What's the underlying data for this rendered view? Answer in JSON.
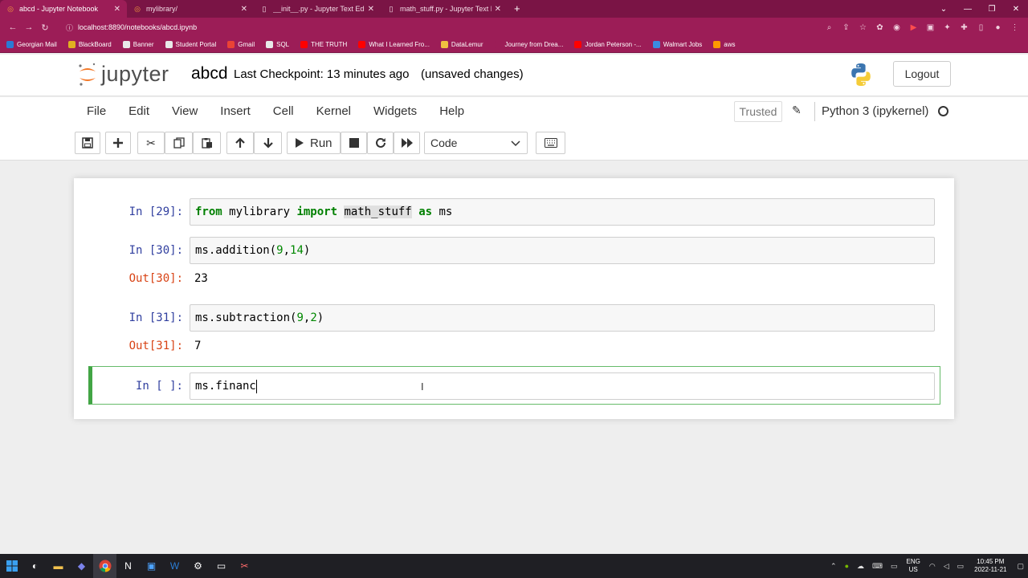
{
  "browser": {
    "tabs": [
      {
        "label": "abcd - Jupyter Notebook",
        "active": true,
        "icon": "jupyter-icon"
      },
      {
        "label": "mylibrary/",
        "active": false,
        "icon": "jupyter-icon"
      },
      {
        "label": "__init__.py - Jupyter Text Editor",
        "active": false,
        "icon": "file-icon"
      },
      {
        "label": "math_stuff.py - Jupyter Text Edito",
        "active": false,
        "icon": "file-icon"
      }
    ],
    "new_tab": "+",
    "url": "localhost:8890/notebooks/abcd.ipynb",
    "bookmarks": [
      {
        "label": "Georgian Mail",
        "color": "#2a7bd4"
      },
      {
        "label": "BlackBoard",
        "color": "#e0b020"
      },
      {
        "label": "Banner",
        "color": "#e8e8e8"
      },
      {
        "label": "Student Portal",
        "color": "#e8e8e8"
      },
      {
        "label": "Gmail",
        "color": "#ea4335"
      },
      {
        "label": "SQL",
        "color": "#e8e8e8"
      },
      {
        "label": "THE TRUTH",
        "color": "#ff0000"
      },
      {
        "label": "What I Learned Fro...",
        "color": "#ff0000"
      },
      {
        "label": "DataLemur",
        "color": "#f0c040"
      },
      {
        "label": "Journey from Drea...",
        "color": "#9c1d57"
      },
      {
        "label": "Jordan Peterson -...",
        "color": "#ff0000"
      },
      {
        "label": "Walmart Jobs",
        "color": "#3a8be0"
      },
      {
        "label": "aws",
        "color": "#ff9900"
      }
    ]
  },
  "jupyter": {
    "logo_text": "jupyter",
    "notebook_name": "abcd",
    "checkpoint": "Last Checkpoint: 13 minutes ago",
    "unsaved": "(unsaved changes)",
    "logout": "Logout",
    "menu": [
      "File",
      "Edit",
      "View",
      "Insert",
      "Cell",
      "Kernel",
      "Widgets",
      "Help"
    ],
    "trusted": "Trusted",
    "kernel": "Python 3 (ipykernel)",
    "run_label": "Run",
    "cell_type": "Code"
  },
  "cells": [
    {
      "in_prompt": "In [29]:",
      "code_parts": [
        "from",
        " mylibrary ",
        "import",
        " ",
        "math_stuff",
        " ",
        "as",
        " ms"
      ]
    },
    {
      "in_prompt": "In [30]:",
      "code_prefix": "ms.addition(",
      "n1": "9",
      "comma": ",",
      "n2": "14",
      "code_suffix": ")",
      "out_prompt": "Out[30]:",
      "output": "23"
    },
    {
      "in_prompt": "In [31]:",
      "code_prefix": "ms.subtraction(",
      "n1": "9",
      "comma": ",",
      "n2": "2",
      "code_suffix": ")",
      "out_prompt": "Out[31]:",
      "output": "7"
    },
    {
      "in_prompt": "In [ ]:",
      "code": "ms.financ"
    }
  ],
  "taskbar": {
    "lang_top": "ENG",
    "lang_bottom": "US",
    "time": "10:45 PM",
    "date": "2022-11-21"
  }
}
